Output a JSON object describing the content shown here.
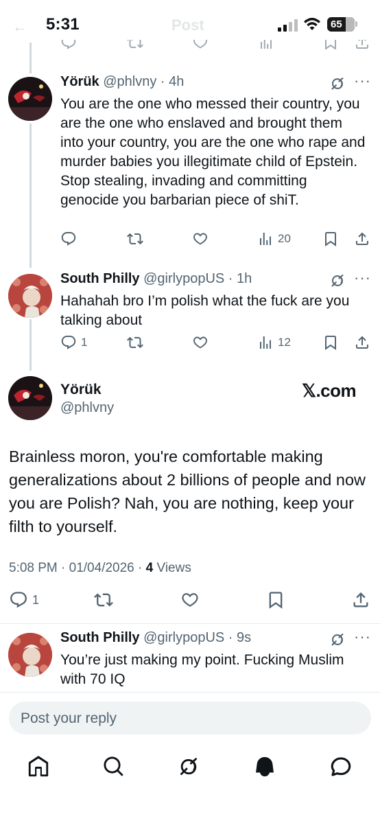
{
  "status_bar": {
    "time": "5:31",
    "battery": "65",
    "ghost_title": "Post"
  },
  "replies": [
    {
      "name": "Yörük",
      "handle": "@phlvny",
      "age": "4h",
      "text": "You are the one who messed their country, you are the one who enslaved and brought them into your country, you are the one who rape and murder babies you illegitimate child of Epstein. Stop stealing, invading and committing genocide you barbarian piece of shiT.",
      "replies_count": "",
      "views": "20"
    },
    {
      "name": "South Philly",
      "handle": "@girlypopUS",
      "age": "1h",
      "text": "Hahahah bro I’m polish what the fuck are you talking about",
      "replies_count": "1",
      "views": "12"
    }
  ],
  "main_post": {
    "name": "Yörük",
    "handle": "@phlvny",
    "watermark": "𝕏.com",
    "body": "Brainless moron, you're comfortable making generalizations about 2 billions of people and now you are Polish? Nah, you are nothing, keep your filth to yourself.",
    "timestamp": "5:08 PM · 01/04/2026 · ",
    "views_count": "4",
    "views_label": "Views",
    "replies_count": "1"
  },
  "last_reply": {
    "name": "South Philly",
    "handle": "@girlypopUS",
    "age": "9s",
    "text": "You’re just making my point. Fucking Muslim with 70 IQ"
  },
  "compose": {
    "placeholder": "Post your reply"
  },
  "colors": {
    "text": "#0f1419",
    "muted": "#536471",
    "thread_line": "#cfd9de",
    "input_bg": "#eff3f4"
  },
  "icons": [
    "reply-icon",
    "repost-icon",
    "like-icon",
    "views-icon",
    "bookmark-icon",
    "share-icon",
    "grok-icon",
    "more-icon",
    "home-icon",
    "search-icon",
    "grok-tab-icon",
    "notifications-icon",
    "messages-icon"
  ]
}
